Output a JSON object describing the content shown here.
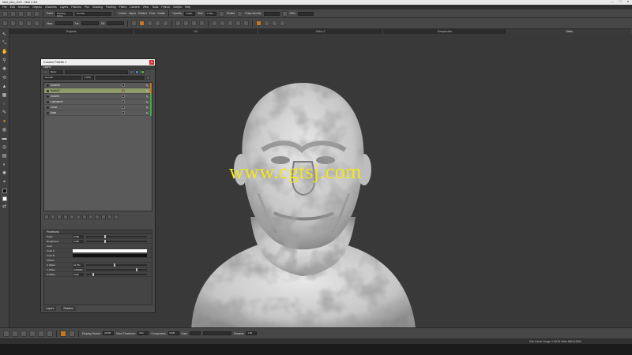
{
  "window": {
    "title": "Mari_intro_2017 - Mari 3.3v1",
    "controls": [
      "—",
      "☐",
      "✕"
    ]
  },
  "menu": [
    "File",
    "Edit",
    "Selection",
    "Objects",
    "Channels",
    "Layers",
    "Patches",
    "Pbo",
    "Shading",
    "Painting",
    "Filters",
    "Camera",
    "View",
    "Tools",
    "Python",
    "Scripts",
    "Help"
  ],
  "toolbar1": {
    "paint_label": "Paint",
    "paint_mode": "Painting Mode",
    "paint_mode_value": "Normal",
    "colors_label": "Colors",
    "alpha_label": "Alpha",
    "radius_label": "Radius",
    "flow_label": "Flow",
    "scalar_label": "Scalar",
    "opacity_label": "Opacity",
    "opacity_value": "1.000",
    "size_label": "Size",
    "size_value": "1.000",
    "rotate_label": "Rotate",
    "snap_label": "Snap density",
    "jitter_label": "Jitter"
  },
  "toolbar2": {
    "near_label": "Near",
    "far_label": "Far",
    "fill_label": "Fill"
  },
  "view_tabs": [
    {
      "label": "Projects",
      "active": false
    },
    {
      "label": "UV",
      "active": false
    },
    {
      "label": "Ortho 2",
      "active": false
    },
    {
      "label": "Perspective",
      "active": false
    },
    {
      "label": "Ortho",
      "active": true
    }
  ],
  "watermark": "www.cgtsj.com",
  "palette": {
    "title": "Custom Palette 1",
    "close": "✕",
    "layers_header": "Layers",
    "channel_value": "Basic",
    "blend_value": "Normal",
    "opacity_value": "1.000",
    "layers": [
      {
        "name": "Noise03",
        "selected": false,
        "blend_orange": false,
        "bar": "#c8781e"
      },
      {
        "name": "Noise02",
        "selected": true,
        "blend_orange": true,
        "bar": "#c8781e"
      },
      {
        "name": "Noise01",
        "selected": false,
        "blend_orange": false,
        "bar": "#3cb14a"
      },
      {
        "name": "Luminance",
        "selected": false,
        "blend_orange": false,
        "bar": "#3cb14a"
      },
      {
        "name": "Cloud",
        "selected": false,
        "blend_orange": false,
        "bar": "#3cb14a"
      },
      {
        "name": "Base",
        "selected": false,
        "blend_orange": false,
        "bar": "#3cb14a"
      }
    ],
    "procedural": {
      "header": "Procedural",
      "rows": [
        {
          "label": "Scale",
          "value": "0.500",
          "knob": 0.3
        },
        {
          "label": "Roughness",
          "value": "0.500",
          "knob": 0.3
        },
        {
          "label": "Color",
          "value": "",
          "knob": null
        },
        {
          "label": "Color A",
          "value": "",
          "color": "#ffffff"
        },
        {
          "label": "Color B",
          "value": "",
          "color": "#111111"
        },
        {
          "label": "Offsets",
          "value": "",
          "knob": null
        },
        {
          "label": "X Offset",
          "value": "12.764",
          "knob": 0.45
        },
        {
          "label": "Y Offset",
          "value": "0.000000",
          "knob": 0.82
        },
        {
          "label": "Z Offset",
          "value": "0.801",
          "knob": 0.1
        }
      ]
    },
    "bottom_tabs": [
      "Layers",
      "Shaders"
    ]
  },
  "bottombar": {
    "display_label": "Display Device",
    "display_value": "sRGB",
    "view_label": "View Transform",
    "view_value": "Film",
    "component_label": "Component",
    "component_value": "RGB",
    "gain_label": "Gain",
    "gamma_label": "Gamma",
    "gamma_value": "1.00"
  },
  "status": "Disk Cache Usage: 0.00GB Video 8851/16384"
}
